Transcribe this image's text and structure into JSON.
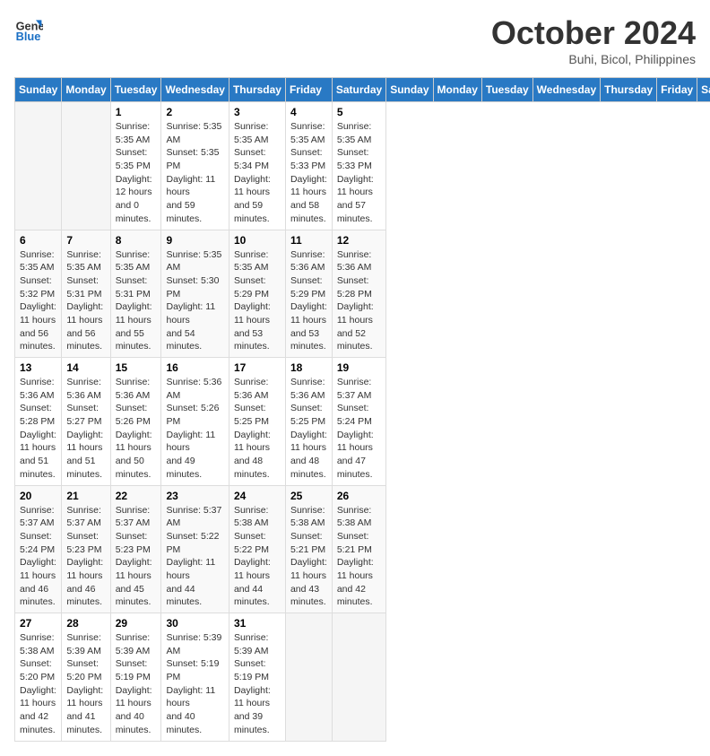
{
  "header": {
    "logo_general": "General",
    "logo_blue": "Blue",
    "month_title": "October 2024",
    "subtitle": "Buhi, Bicol, Philippines"
  },
  "calendar": {
    "days_of_week": [
      "Sunday",
      "Monday",
      "Tuesday",
      "Wednesday",
      "Thursday",
      "Friday",
      "Saturday"
    ],
    "weeks": [
      [
        {
          "day": "",
          "details": ""
        },
        {
          "day": "",
          "details": ""
        },
        {
          "day": "1",
          "details": "Sunrise: 5:35 AM\nSunset: 5:35 PM\nDaylight: 12 hours\nand 0 minutes."
        },
        {
          "day": "2",
          "details": "Sunrise: 5:35 AM\nSunset: 5:35 PM\nDaylight: 11 hours\nand 59 minutes."
        },
        {
          "day": "3",
          "details": "Sunrise: 5:35 AM\nSunset: 5:34 PM\nDaylight: 11 hours\nand 59 minutes."
        },
        {
          "day": "4",
          "details": "Sunrise: 5:35 AM\nSunset: 5:33 PM\nDaylight: 11 hours\nand 58 minutes."
        },
        {
          "day": "5",
          "details": "Sunrise: 5:35 AM\nSunset: 5:33 PM\nDaylight: 11 hours\nand 57 minutes."
        }
      ],
      [
        {
          "day": "6",
          "details": "Sunrise: 5:35 AM\nSunset: 5:32 PM\nDaylight: 11 hours\nand 56 minutes."
        },
        {
          "day": "7",
          "details": "Sunrise: 5:35 AM\nSunset: 5:31 PM\nDaylight: 11 hours\nand 56 minutes."
        },
        {
          "day": "8",
          "details": "Sunrise: 5:35 AM\nSunset: 5:31 PM\nDaylight: 11 hours\nand 55 minutes."
        },
        {
          "day": "9",
          "details": "Sunrise: 5:35 AM\nSunset: 5:30 PM\nDaylight: 11 hours\nand 54 minutes."
        },
        {
          "day": "10",
          "details": "Sunrise: 5:35 AM\nSunset: 5:29 PM\nDaylight: 11 hours\nand 53 minutes."
        },
        {
          "day": "11",
          "details": "Sunrise: 5:36 AM\nSunset: 5:29 PM\nDaylight: 11 hours\nand 53 minutes."
        },
        {
          "day": "12",
          "details": "Sunrise: 5:36 AM\nSunset: 5:28 PM\nDaylight: 11 hours\nand 52 minutes."
        }
      ],
      [
        {
          "day": "13",
          "details": "Sunrise: 5:36 AM\nSunset: 5:28 PM\nDaylight: 11 hours\nand 51 minutes."
        },
        {
          "day": "14",
          "details": "Sunrise: 5:36 AM\nSunset: 5:27 PM\nDaylight: 11 hours\nand 51 minutes."
        },
        {
          "day": "15",
          "details": "Sunrise: 5:36 AM\nSunset: 5:26 PM\nDaylight: 11 hours\nand 50 minutes."
        },
        {
          "day": "16",
          "details": "Sunrise: 5:36 AM\nSunset: 5:26 PM\nDaylight: 11 hours\nand 49 minutes."
        },
        {
          "day": "17",
          "details": "Sunrise: 5:36 AM\nSunset: 5:25 PM\nDaylight: 11 hours\nand 48 minutes."
        },
        {
          "day": "18",
          "details": "Sunrise: 5:36 AM\nSunset: 5:25 PM\nDaylight: 11 hours\nand 48 minutes."
        },
        {
          "day": "19",
          "details": "Sunrise: 5:37 AM\nSunset: 5:24 PM\nDaylight: 11 hours\nand 47 minutes."
        }
      ],
      [
        {
          "day": "20",
          "details": "Sunrise: 5:37 AM\nSunset: 5:24 PM\nDaylight: 11 hours\nand 46 minutes."
        },
        {
          "day": "21",
          "details": "Sunrise: 5:37 AM\nSunset: 5:23 PM\nDaylight: 11 hours\nand 46 minutes."
        },
        {
          "day": "22",
          "details": "Sunrise: 5:37 AM\nSunset: 5:23 PM\nDaylight: 11 hours\nand 45 minutes."
        },
        {
          "day": "23",
          "details": "Sunrise: 5:37 AM\nSunset: 5:22 PM\nDaylight: 11 hours\nand 44 minutes."
        },
        {
          "day": "24",
          "details": "Sunrise: 5:38 AM\nSunset: 5:22 PM\nDaylight: 11 hours\nand 44 minutes."
        },
        {
          "day": "25",
          "details": "Sunrise: 5:38 AM\nSunset: 5:21 PM\nDaylight: 11 hours\nand 43 minutes."
        },
        {
          "day": "26",
          "details": "Sunrise: 5:38 AM\nSunset: 5:21 PM\nDaylight: 11 hours\nand 42 minutes."
        }
      ],
      [
        {
          "day": "27",
          "details": "Sunrise: 5:38 AM\nSunset: 5:20 PM\nDaylight: 11 hours\nand 42 minutes."
        },
        {
          "day": "28",
          "details": "Sunrise: 5:39 AM\nSunset: 5:20 PM\nDaylight: 11 hours\nand 41 minutes."
        },
        {
          "day": "29",
          "details": "Sunrise: 5:39 AM\nSunset: 5:19 PM\nDaylight: 11 hours\nand 40 minutes."
        },
        {
          "day": "30",
          "details": "Sunrise: 5:39 AM\nSunset: 5:19 PM\nDaylight: 11 hours\nand 40 minutes."
        },
        {
          "day": "31",
          "details": "Sunrise: 5:39 AM\nSunset: 5:19 PM\nDaylight: 11 hours\nand 39 minutes."
        },
        {
          "day": "",
          "details": ""
        },
        {
          "day": "",
          "details": ""
        }
      ]
    ]
  }
}
